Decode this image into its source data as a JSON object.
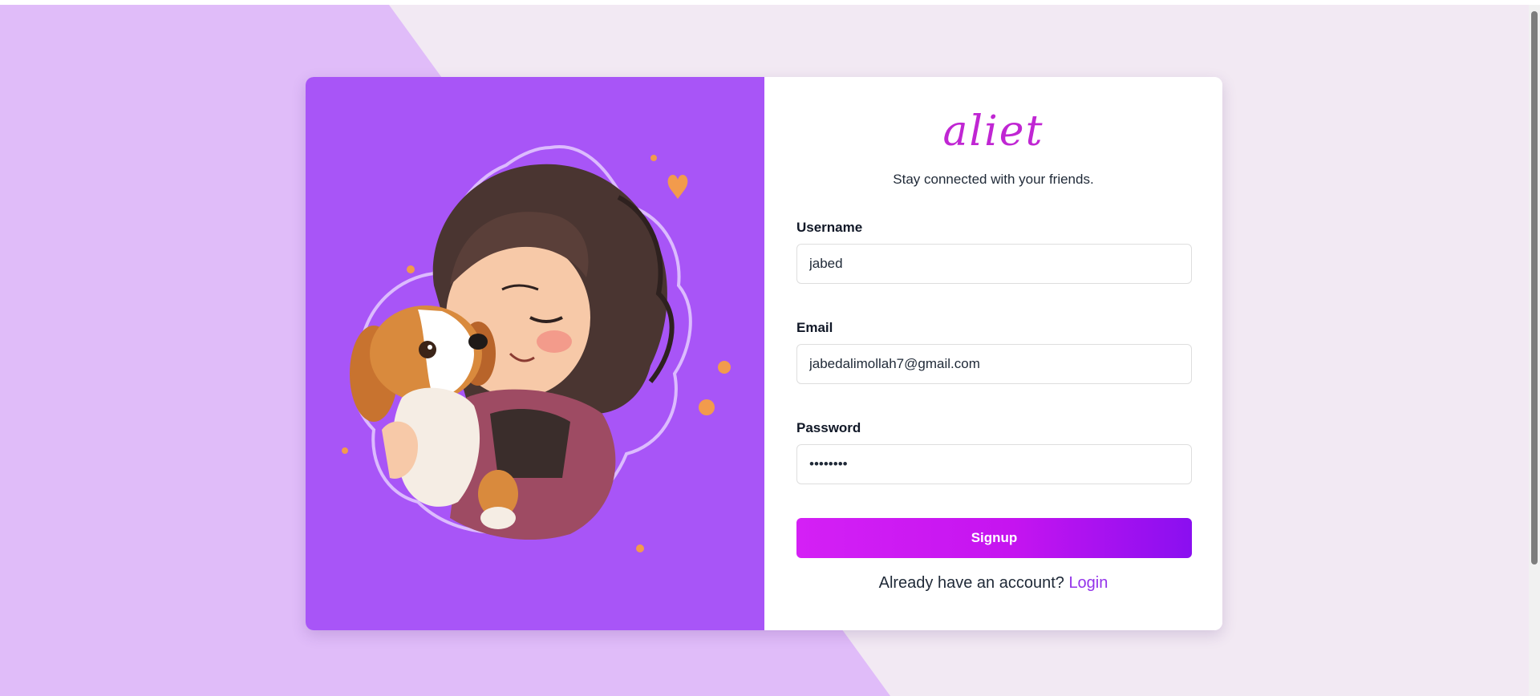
{
  "brand": {
    "logo_text": "aliet",
    "tagline": "Stay connected with your friends."
  },
  "form": {
    "username_label": "Username",
    "username_value": "jabed",
    "email_label": "Email",
    "email_value": "jabedalimollah7@gmail.com",
    "password_label": "Password",
    "password_value": "••••••••",
    "submit_label": "Signup"
  },
  "footer": {
    "prompt": "Already have an account?",
    "login_link": "Login"
  },
  "illustration": {
    "subject": "girl-hugging-puppy-sticker"
  },
  "colors": {
    "page_background": "#f2e9f3",
    "background_accent": "#e0bcf9",
    "panel_purple": "#a855f7",
    "button_start": "#d420f5",
    "button_end": "#8a0ff0",
    "link": "#9333ea",
    "logo": "#c026d3"
  }
}
